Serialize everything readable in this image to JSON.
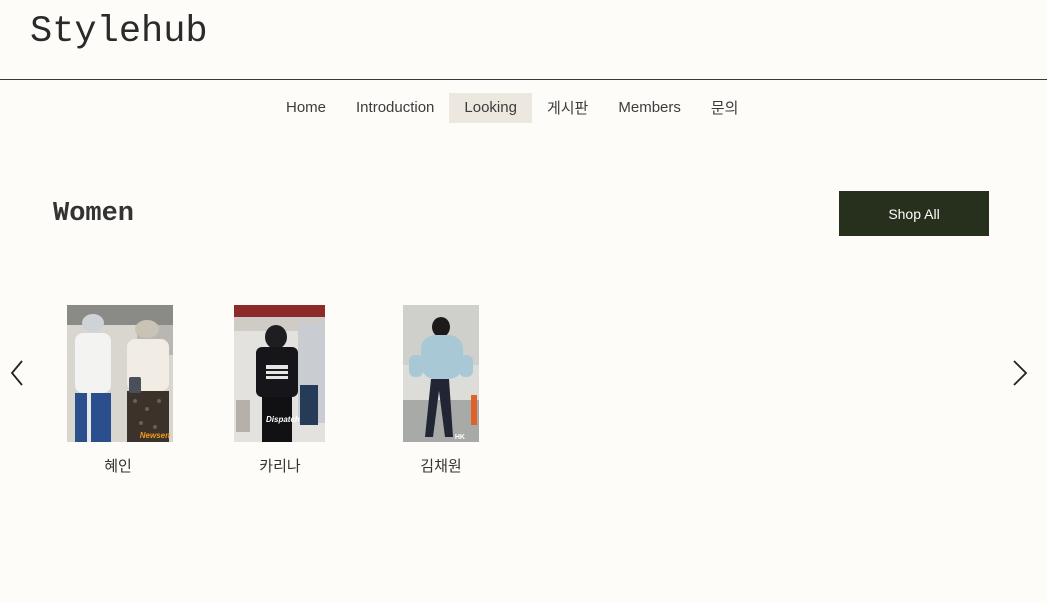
{
  "site": {
    "logo": "Stylehub"
  },
  "nav": {
    "items": [
      {
        "label": "Home"
      },
      {
        "label": "Introduction"
      },
      {
        "label": "Looking"
      },
      {
        "label": "게시판"
      },
      {
        "label": "Members"
      },
      {
        "label": "문의"
      }
    ],
    "active": "Looking"
  },
  "section": {
    "title": "Women",
    "shop_all_label": "Shop All"
  },
  "cards": [
    {
      "name": "혜인",
      "watermark": "Newsen"
    },
    {
      "name": "카리나",
      "watermark": "Dispatch"
    },
    {
      "name": "김채원",
      "watermark": "HK"
    }
  ],
  "icons": {
    "prev": "chevron-left-icon",
    "next": "chevron-right-icon"
  },
  "colors": {
    "background": "#fdfcf8",
    "accent_button": "#272f1d",
    "active_nav": "#ece7df"
  }
}
